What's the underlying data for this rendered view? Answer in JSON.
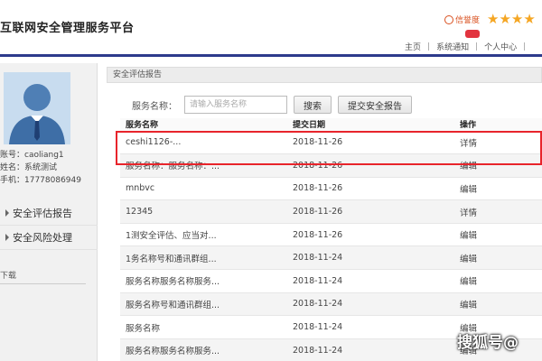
{
  "header": {
    "site_title": "互联网安全管理服务平台",
    "rating_label": "信誉度",
    "nav": [
      "主页",
      "系统通知",
      "个人中心"
    ]
  },
  "user": {
    "account": "账号：caoliang1",
    "name": "姓名：系统测试",
    "phone": "手机：17778086949"
  },
  "sidebar": {
    "menu": [
      "安全评估报告",
      "安全风险处理"
    ],
    "download_label": "下载"
  },
  "panel": {
    "title": "安全评估报告",
    "search_label": "服务名称：",
    "search_placeholder": "请输入服务名称",
    "search_button": "搜索",
    "submit_button": "提交安全报告"
  },
  "table": {
    "headers": [
      "服务名称",
      "提交日期",
      "操作"
    ],
    "rows": [
      [
        "ceshi1126-...",
        "2018-11-26",
        "详情"
      ],
      [
        "服务名称：服务名称：...",
        "2018-11-26",
        "编辑"
      ],
      [
        "mnbvc",
        "2018-11-26",
        "编辑"
      ],
      [
        "12345",
        "2018-11-26",
        "详情"
      ],
      [
        "1测安全评估、应当对...",
        "2018-11-26",
        "编辑"
      ],
      [
        "1务名称号和通讯群组...",
        "2018-11-24",
        "编辑"
      ],
      [
        "服务名称服务名称服务...",
        "2018-11-24",
        "编辑"
      ],
      [
        "服务名称号和通讯群组...",
        "2018-11-24",
        "编辑"
      ],
      [
        "服务名称",
        "2018-11-24",
        "编辑"
      ],
      [
        "服务名称服务名称服务...",
        "2018-11-24",
        "编辑"
      ]
    ]
  },
  "watermark": "搜狐号@",
  "colors": {
    "accent_bar": "#2d3a8c",
    "highlight": "#e8242b",
    "stars": "#f5a623",
    "rating": "#d9501f"
  }
}
